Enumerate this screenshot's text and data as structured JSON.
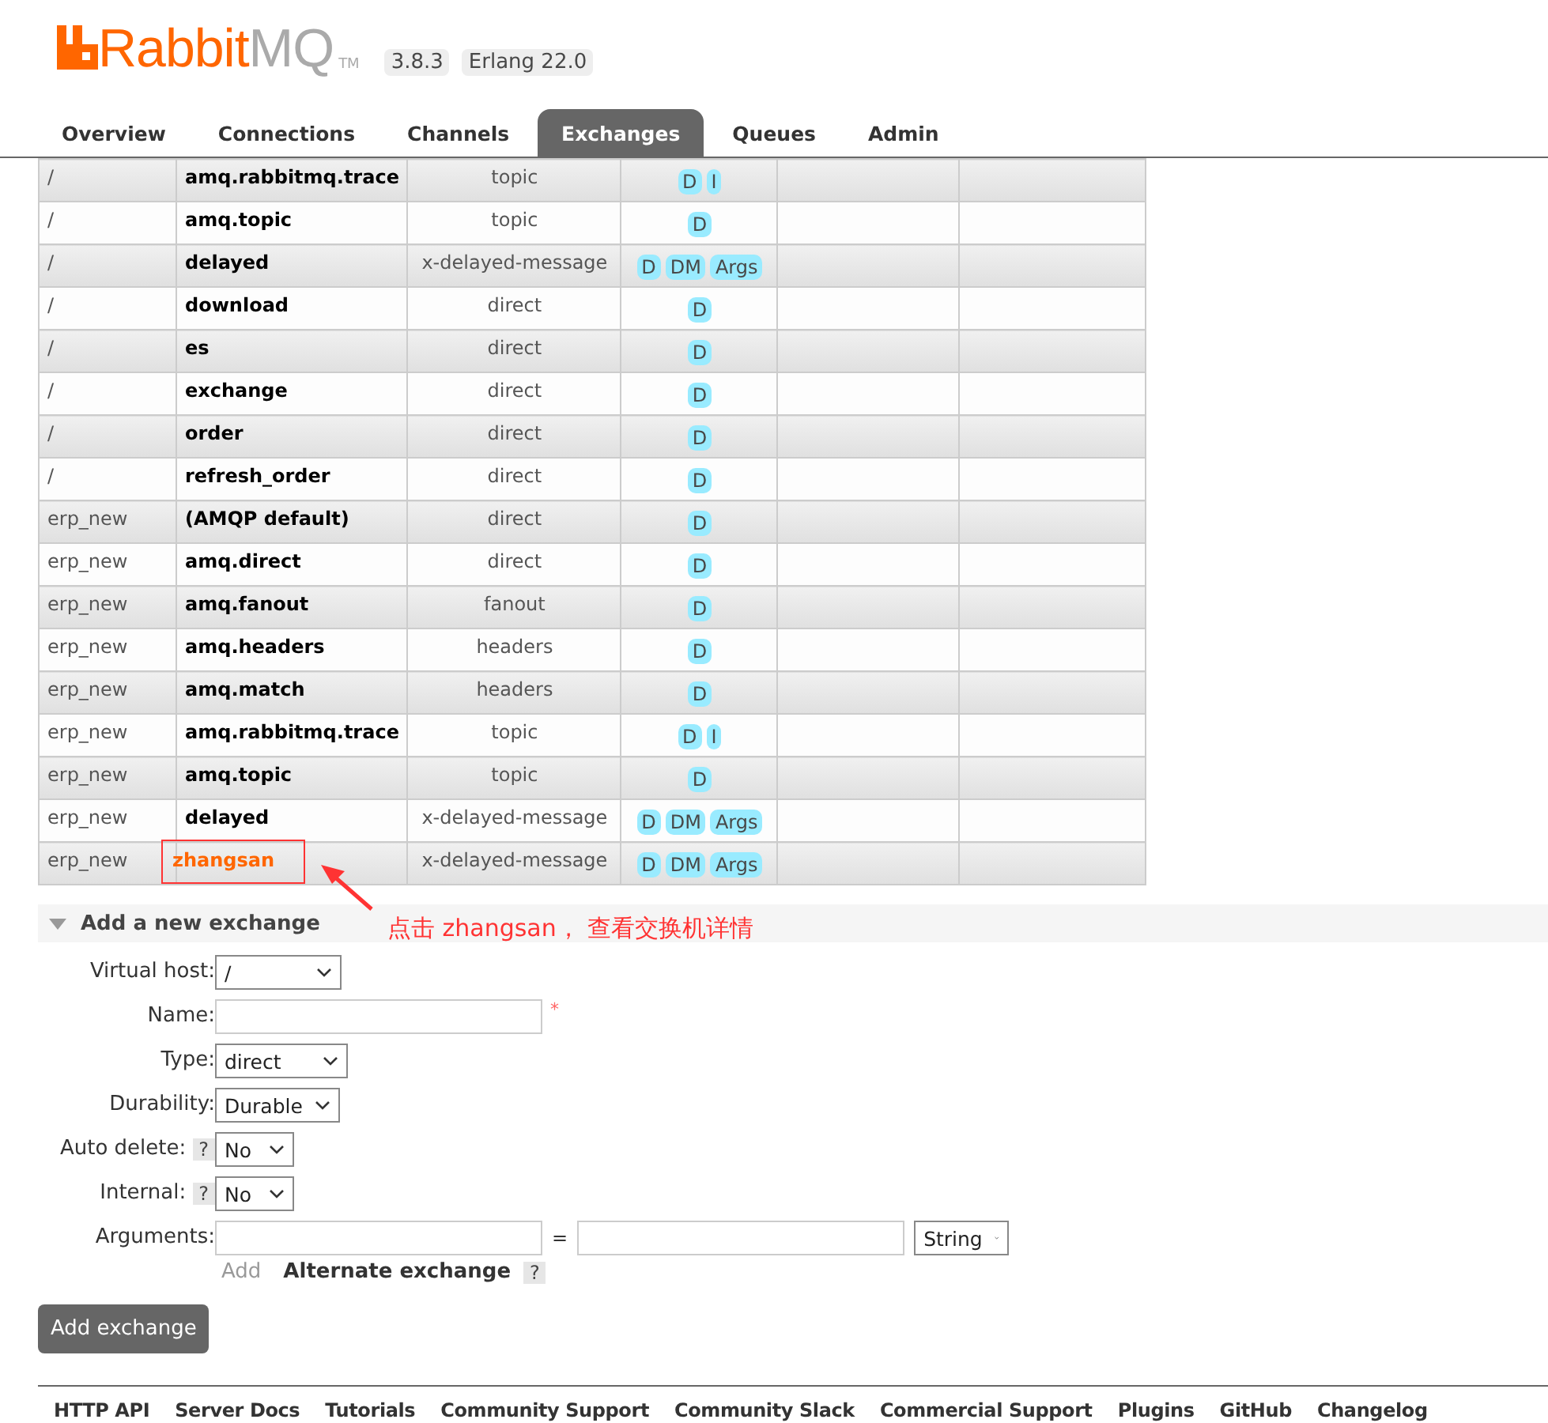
{
  "header": {
    "brand_main": "Rabbit",
    "brand_rest": "MQ",
    "trademark": "TM",
    "version": "3.8.3",
    "erlang": "Erlang 22.0"
  },
  "tabs": [
    {
      "label": "Overview",
      "selected": false
    },
    {
      "label": "Connections",
      "selected": false
    },
    {
      "label": "Channels",
      "selected": false
    },
    {
      "label": "Exchanges",
      "selected": true
    },
    {
      "label": "Queues",
      "selected": false
    },
    {
      "label": "Admin",
      "selected": false
    }
  ],
  "exchanges": [
    {
      "vhost": "/",
      "name": "amq.rabbitmq.trace",
      "type": "topic",
      "features": [
        "D",
        "I"
      ],
      "highlighted": false
    },
    {
      "vhost": "/",
      "name": "amq.topic",
      "type": "topic",
      "features": [
        "D"
      ],
      "highlighted": false
    },
    {
      "vhost": "/",
      "name": "delayed",
      "type": "x-delayed-message",
      "features": [
        "D",
        "DM",
        "Args"
      ],
      "highlighted": false
    },
    {
      "vhost": "/",
      "name": "download",
      "type": "direct",
      "features": [
        "D"
      ],
      "highlighted": false
    },
    {
      "vhost": "/",
      "name": "es",
      "type": "direct",
      "features": [
        "D"
      ],
      "highlighted": false
    },
    {
      "vhost": "/",
      "name": "exchange",
      "type": "direct",
      "features": [
        "D"
      ],
      "highlighted": false
    },
    {
      "vhost": "/",
      "name": "order",
      "type": "direct",
      "features": [
        "D"
      ],
      "highlighted": false
    },
    {
      "vhost": "/",
      "name": "refresh_order",
      "type": "direct",
      "features": [
        "D"
      ],
      "highlighted": false
    },
    {
      "vhost": "erp_new",
      "name": "(AMQP default)",
      "type": "direct",
      "features": [
        "D"
      ],
      "highlighted": false
    },
    {
      "vhost": "erp_new",
      "name": "amq.direct",
      "type": "direct",
      "features": [
        "D"
      ],
      "highlighted": false
    },
    {
      "vhost": "erp_new",
      "name": "amq.fanout",
      "type": "fanout",
      "features": [
        "D"
      ],
      "highlighted": false
    },
    {
      "vhost": "erp_new",
      "name": "amq.headers",
      "type": "headers",
      "features": [
        "D"
      ],
      "highlighted": false
    },
    {
      "vhost": "erp_new",
      "name": "amq.match",
      "type": "headers",
      "features": [
        "D"
      ],
      "highlighted": false
    },
    {
      "vhost": "erp_new",
      "name": "amq.rabbitmq.trace",
      "type": "topic",
      "features": [
        "D",
        "I"
      ],
      "highlighted": false
    },
    {
      "vhost": "erp_new",
      "name": "amq.topic",
      "type": "topic",
      "features": [
        "D"
      ],
      "highlighted": false
    },
    {
      "vhost": "erp_new",
      "name": "delayed",
      "type": "x-delayed-message",
      "features": [
        "D",
        "DM",
        "Args"
      ],
      "highlighted": false
    },
    {
      "vhost": "erp_new",
      "name": "zhangsan",
      "type": "x-delayed-message",
      "features": [
        "D",
        "DM",
        "Args"
      ],
      "highlighted": true
    }
  ],
  "annotation": {
    "text": "点击 zhangsan， 查看交换机详情"
  },
  "add_section": {
    "title": "Add a new exchange",
    "expanded": true,
    "fields": [
      {
        "kind": "select",
        "label": "Virtual host:",
        "value": "/",
        "help": false
      },
      {
        "kind": "text",
        "label": "Name:",
        "required": true,
        "help": false
      },
      {
        "kind": "select",
        "label": "Type:",
        "value": "direct",
        "help": false
      },
      {
        "kind": "select",
        "label": "Durability:",
        "value": "Durable",
        "help": false
      },
      {
        "kind": "select",
        "label": "Auto delete:",
        "value": "No",
        "help": true
      },
      {
        "kind": "select",
        "label": "Internal:",
        "value": "No",
        "help": true
      },
      {
        "kind": "pair",
        "label": "Arguments:",
        "separator": "=",
        "value_type": "String",
        "help": false
      }
    ],
    "required_mark": "*",
    "add_link": "Add",
    "alternate_label": "Alternate exchange",
    "help_mark": "?",
    "submit": "Add exchange"
  },
  "footer": [
    "HTTP API",
    "Server Docs",
    "Tutorials",
    "Community Support",
    "Community Slack",
    "Commercial Support",
    "Plugins",
    "GitHub",
    "Changelog"
  ]
}
